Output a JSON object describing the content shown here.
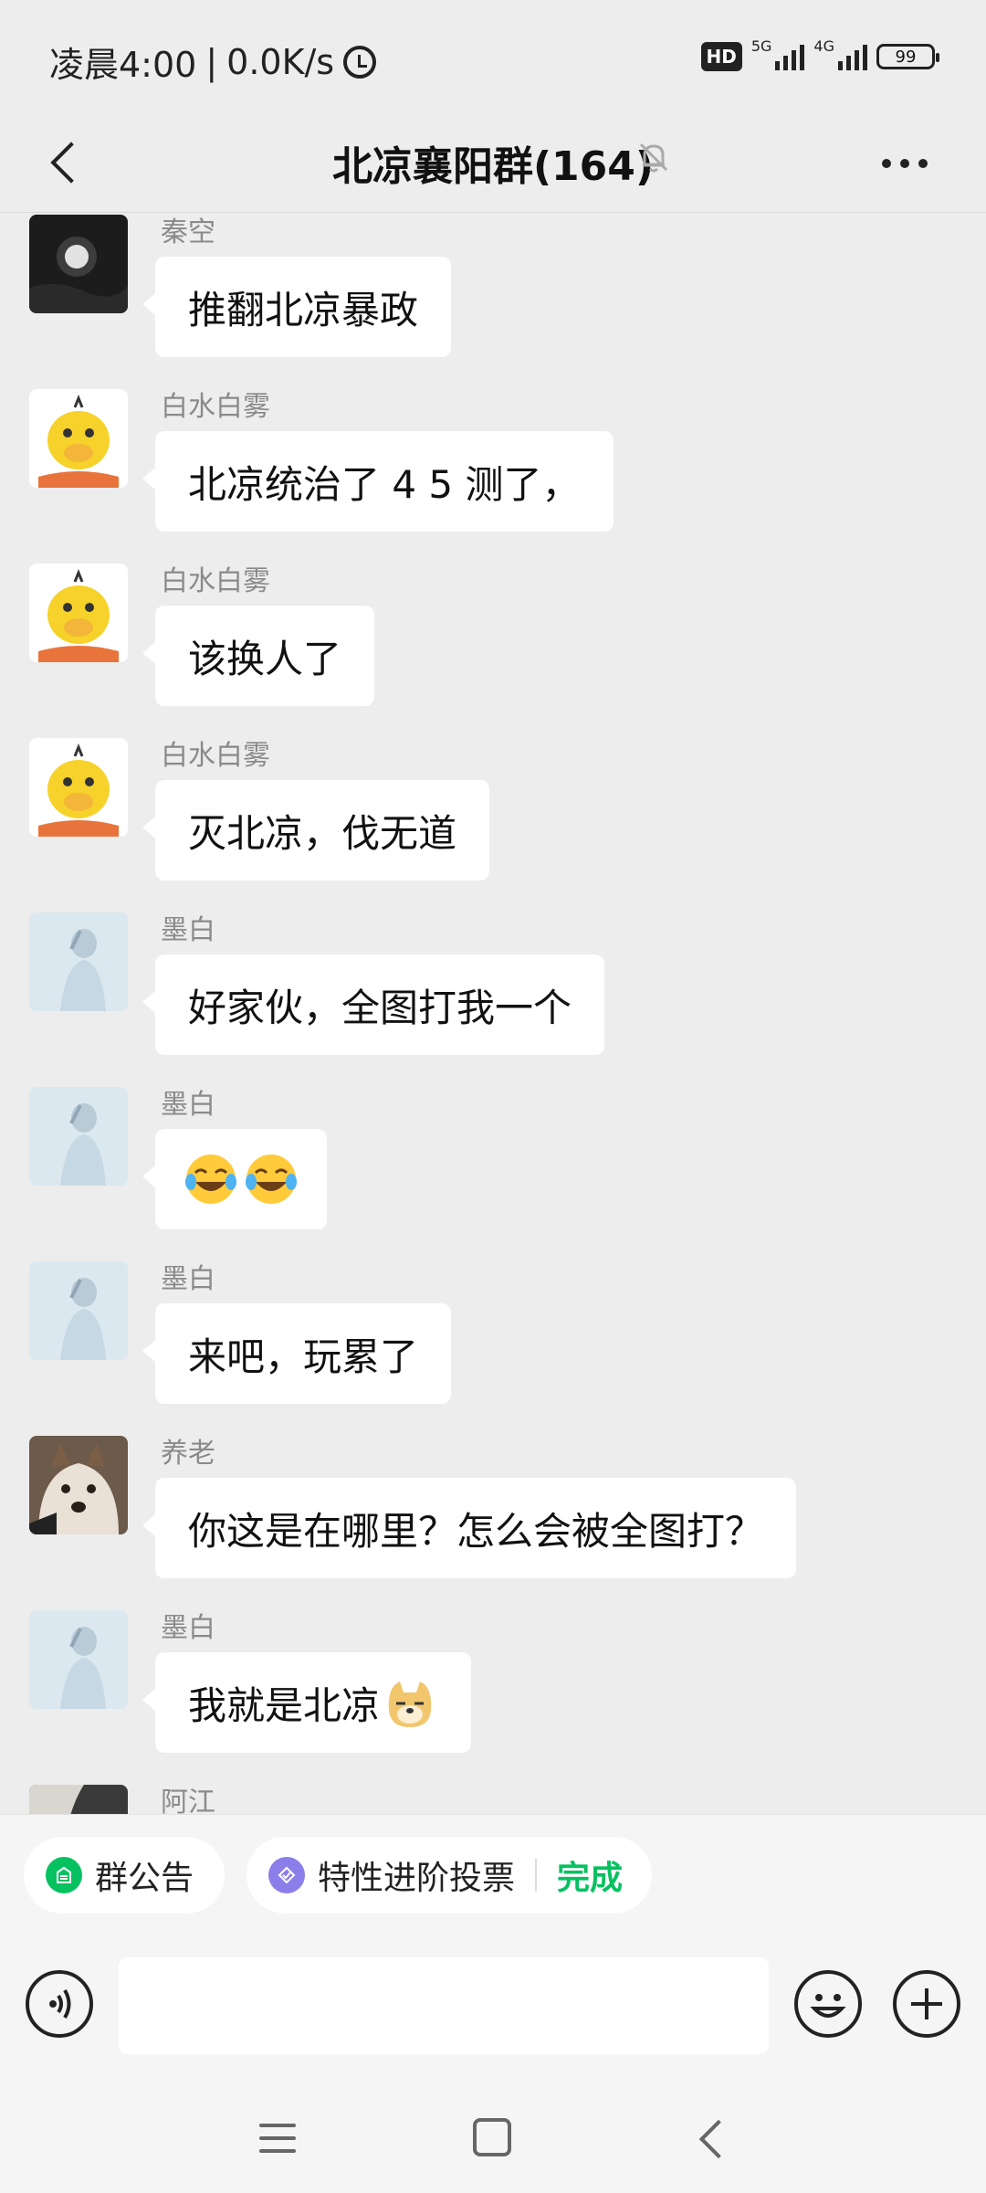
{
  "status_bar": {
    "time": "凌晨4:00",
    "speed": "0.0K/s",
    "separator": "|",
    "hd": "HD",
    "net_5g": "5G",
    "net_4g": "4G",
    "battery": "99"
  },
  "header": {
    "title": "北凉襄阳群(164)",
    "icons": [
      "back-icon",
      "mute-bell-icon",
      "more-icon"
    ]
  },
  "messages": [
    {
      "sender": "秦空",
      "text": "推翻北凉暴政",
      "avatar": "moon-night"
    },
    {
      "sender": "白水白雾",
      "text": "北凉统治了 4 5 测了，",
      "avatar": "yellow-duck"
    },
    {
      "sender": "白水白雾",
      "text": "该换人了",
      "avatar": "yellow-duck"
    },
    {
      "sender": "白水白雾",
      "text": "灭北凉，伐无道",
      "avatar": "yellow-duck"
    },
    {
      "sender": "墨白",
      "text": "好家伙，全图打我一个",
      "avatar": "blue-figure"
    },
    {
      "sender": "墨白",
      "text": "",
      "emoji": [
        "tears-of-joy",
        "tears-of-joy"
      ],
      "avatar": "blue-figure"
    },
    {
      "sender": "墨白",
      "text": "来吧，玩累了",
      "avatar": "blue-figure"
    },
    {
      "sender": "养老",
      "text": "你这是在哪里？怎么会被全图打？",
      "avatar": "husky-dog"
    },
    {
      "sender": "墨白",
      "text": "我就是北凉",
      "emoji": [
        "doge"
      ],
      "avatar": "blue-figure"
    },
    {
      "sender": "阿江",
      "text": "",
      "avatar": "dark-partial"
    }
  ],
  "bottom": {
    "chips": {
      "announcement": "群公告",
      "vote": "特性进阶投票",
      "done": "完成"
    },
    "input_placeholder": ""
  },
  "colors": {
    "background": "#ededed",
    "bubble": "#ffffff",
    "accent_green": "#07c160",
    "vote_purple": "#8c7ee8"
  }
}
